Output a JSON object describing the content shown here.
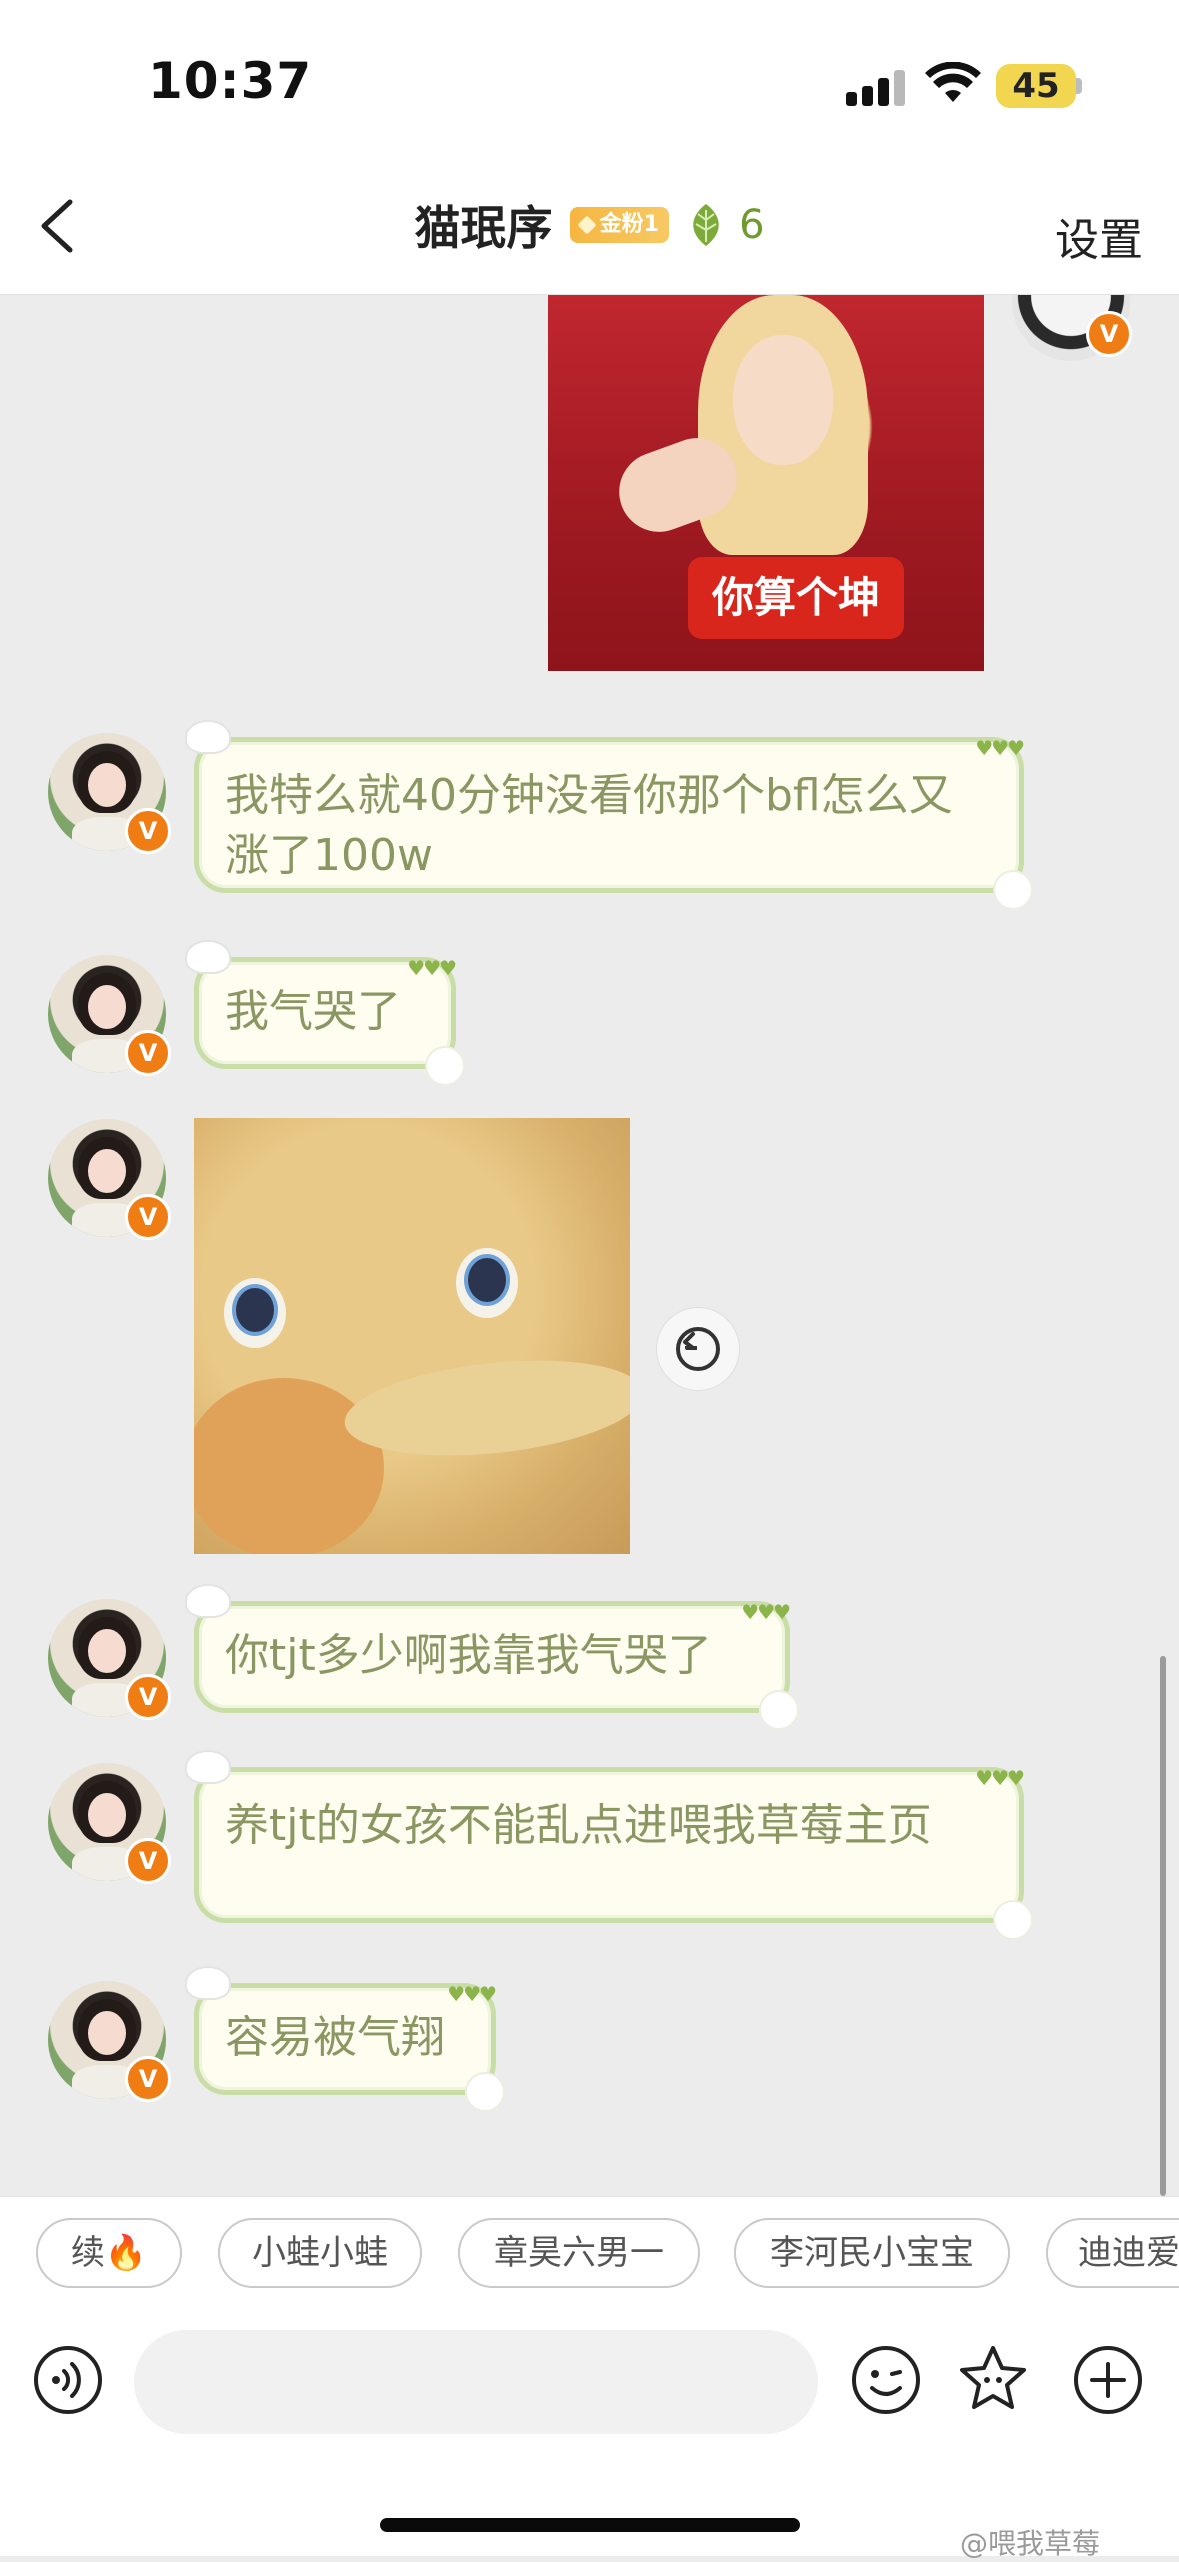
{
  "status_bar": {
    "time": "10:37",
    "battery": "45"
  },
  "nav": {
    "back_icon": "chevron-left-icon",
    "title": "猫珉序",
    "fan_badge": "金粉1",
    "leaf_count": "6",
    "settings": "设置"
  },
  "messages": [
    {
      "type": "image",
      "sender": "me",
      "caption": "你算个坤"
    },
    {
      "type": "text",
      "sender": "other",
      "text": "我特么就40分钟没看你那个bfl怎么又涨了100w"
    },
    {
      "type": "text",
      "sender": "other",
      "text": "我气哭了"
    },
    {
      "type": "image",
      "sender": "other",
      "caption": ""
    },
    {
      "type": "text",
      "sender": "other",
      "text": "你tjt多少啊我靠我气哭了"
    },
    {
      "type": "text",
      "sender": "other",
      "text": "养tjt的女孩不能乱点进喂我草莓主页"
    },
    {
      "type": "text",
      "sender": "other",
      "text": "容易被气翔"
    }
  ],
  "verified_badge": "V",
  "quick_replies": [
    "续🔥",
    "小蛙小蛙",
    "章昊六男一",
    "李河民小宝宝",
    "迪迪爱"
  ],
  "input": {
    "placeholder": ""
  },
  "watermark": "@喂我草莓",
  "colors": {
    "bubble_text": "#8a9763",
    "bubble_border": "#c9dda6",
    "badge_orange": "#f07c14",
    "caption_red": "#d9261d"
  }
}
